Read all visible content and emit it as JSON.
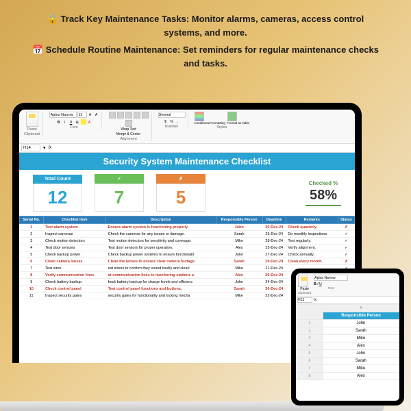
{
  "promo": {
    "line1": "🔒 Track Key Maintenance Tasks: Monitor alarms, cameras, access control systems, and more.",
    "line2": "📅 Schedule Routine Maintenance: Set reminders for regular maintenance checks and tasks."
  },
  "ribbon": {
    "paste": "Paste",
    "clipboard": "Clipboard",
    "font_name": "Aptos Narrow",
    "font_size": "11",
    "font_grp": "Font",
    "align_grp": "Alignment",
    "wrap": "Wrap Text",
    "merge": "Merge & Center",
    "num_fmt": "General",
    "num_grp": "Number",
    "cond": "Conditional Formatting",
    "table": "Format as Table",
    "styles": "Styles"
  },
  "cellref": {
    "name": "H14",
    "fx": ""
  },
  "sheet_title": "Security System Maintenance Checklist",
  "cards": {
    "total": {
      "label": "Total Count",
      "value": "12"
    },
    "done": {
      "label": "✓",
      "value": "7"
    },
    "undone": {
      "label": "✗",
      "value": "5"
    },
    "pct": {
      "label": "Checked %",
      "value": "58%"
    }
  },
  "cols": [
    "Serial No.",
    "Checklist Item",
    "Description",
    "Responsible Person",
    "Deadline",
    "Remarks",
    "Status"
  ],
  "rows": [
    {
      "n": "1",
      "item": "Test alarm system",
      "desc": "Ensure alarm system is functioning properly.",
      "who": "John",
      "due": "30-Dec-24",
      "rem": "Check quarterly.",
      "st": "✗",
      "red": true
    },
    {
      "n": "2",
      "item": "Inspect cameras",
      "desc": "Check the cameras for any issues or damage.",
      "who": "Sarah",
      "due": "25-Dec-24",
      "rem": "Do monthly inspections.",
      "st": "✓"
    },
    {
      "n": "3",
      "item": "Check motion detectors",
      "desc": "Test motion detectors for sensitivity and coverage.",
      "who": "Mike",
      "due": "28-Dec-24",
      "rem": "Test regularly.",
      "st": "✓"
    },
    {
      "n": "4",
      "item": "Test door sensors",
      "desc": "Test door sensors for proper operation.",
      "who": "Alex",
      "due": "23-Dec-24",
      "rem": "Verify alignment.",
      "st": "✓"
    },
    {
      "n": "5",
      "item": "Check backup power",
      "desc": "Check backup power systems to ensure functionalit",
      "who": "John",
      "due": "27-Dec-24",
      "rem": "Check annually.",
      "st": "✓"
    },
    {
      "n": "6",
      "item": "Clean camera lenses",
      "desc": "Clean the lenses to ensure clear camera footage.",
      "who": "Sarah",
      "due": "29-Dec-24",
      "rem": "Clean every month.",
      "st": "✗",
      "red": true
    },
    {
      "n": "7",
      "item": "Test siren",
      "desc": "est sirens to confirm they sound loudly and clearl",
      "who": "Mike",
      "due": "21-Dec-24",
      "rem": "",
      "st": "✓"
    },
    {
      "n": "8",
      "item": "Verify communication lines",
      "desc": "at communication lines to monitoring stations a",
      "who": "Alex",
      "due": "26-Dec-24",
      "rem": "",
      "st": "✗",
      "red": true
    },
    {
      "n": "9",
      "item": "Check battery backup",
      "desc": "heck battery backup for charge levels and efficienc",
      "who": "John",
      "due": "24-Dec-24",
      "rem": "",
      "st": ""
    },
    {
      "n": "10",
      "item": "Check control panel",
      "desc": "Test control panel functions and buttons.",
      "who": "Sarah",
      "due": "30-Dec-24",
      "rem": "",
      "st": "",
      "red": true
    },
    {
      "n": "11",
      "item": "Inspect security gates",
      "desc": "security gates for functionality and locking mecha",
      "who": "Mike",
      "due": "22-Dec-24",
      "rem": "",
      "st": ""
    }
  ],
  "tablet": {
    "cellref": "H13",
    "col_header": "Responsible Person",
    "names": [
      "John",
      "Sarah",
      "Mike",
      "Alex",
      "John",
      "Sarah",
      "Mike",
      "Alex"
    ]
  }
}
